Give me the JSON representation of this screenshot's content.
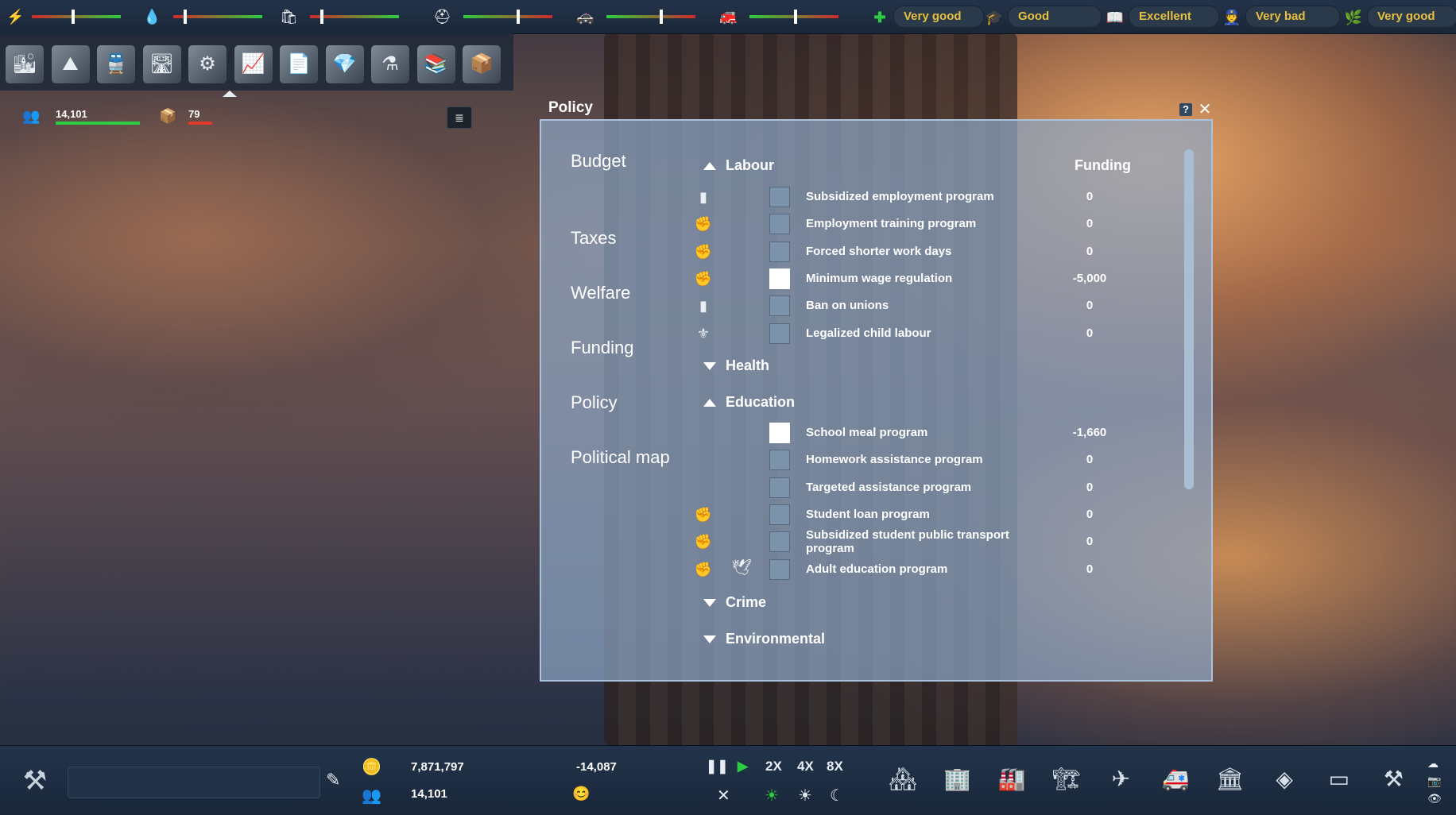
{
  "topbar": {
    "meters": [
      {
        "icon": "lightning-icon",
        "level": 0.45
      },
      {
        "icon": "water-drop-icon",
        "level": 0.12
      },
      {
        "icon": "garbage-bag-icon",
        "level": 0.12
      },
      {
        "icon": "worker-helmet-icon",
        "level": 0.6
      },
      {
        "icon": "police-icon",
        "level": 0.6
      },
      {
        "icon": "fire-icon",
        "level": 0.5
      }
    ],
    "ratings": [
      {
        "icon": "health-cross-icon",
        "label": "Very good"
      },
      {
        "icon": "education-icon",
        "label": "Good"
      },
      {
        "icon": "book-icon",
        "label": "Excellent"
      },
      {
        "icon": "crime-icon",
        "label": "Very bad"
      },
      {
        "icon": "environment-icon",
        "label": "Very good"
      }
    ]
  },
  "toolbar": {
    "tools": [
      {
        "name": "city-overview-tool",
        "glyph": "🏙"
      },
      {
        "name": "terrain-tool",
        "glyph": "⛰"
      },
      {
        "name": "transport-tool",
        "glyph": "🚆"
      },
      {
        "name": "roads-tool",
        "glyph": "🛣"
      },
      {
        "name": "power-tool",
        "glyph": "⚙"
      },
      {
        "name": "economy-tool",
        "glyph": "📈"
      },
      {
        "name": "documents-tool",
        "glyph": "📄"
      },
      {
        "name": "resources-tool",
        "glyph": "💎"
      },
      {
        "name": "research-tool",
        "glyph": "⚗"
      },
      {
        "name": "statistics-tool",
        "glyph": "📚"
      },
      {
        "name": "storage-tool",
        "glyph": "📦"
      }
    ]
  },
  "stats": {
    "population": "14,101",
    "goods": "79"
  },
  "window": {
    "title": "Policy",
    "help": "?",
    "close": "✕",
    "nav": [
      "Budget",
      "Taxes",
      "Welfare",
      "Funding",
      "Policy",
      "Political map"
    ],
    "funding_header": "Funding",
    "sections": [
      {
        "title": "Labour",
        "expanded": true,
        "rows": [
          {
            "icon": "union-icon",
            "glyph": "▮",
            "checked": false,
            "label": "Subsidized employment program",
            "value": "0"
          },
          {
            "icon": "fist-icon",
            "glyph": "✊",
            "checked": false,
            "label": "Employment training program",
            "value": "0"
          },
          {
            "icon": "fist-icon",
            "glyph": "✊",
            "checked": false,
            "label": "Forced shorter work days",
            "value": "0"
          },
          {
            "icon": "fist-icon",
            "glyph": "✊",
            "checked": true,
            "label": "Minimum wage regulation",
            "value": "-5,000"
          },
          {
            "icon": "union-icon",
            "glyph": "▮",
            "checked": false,
            "label": "Ban on unions",
            "value": "0"
          },
          {
            "icon": "eagle-icon",
            "glyph": "⚜",
            "checked": false,
            "label": "Legalized child labour",
            "value": "0"
          }
        ]
      },
      {
        "title": "Health",
        "expanded": false,
        "rows": []
      },
      {
        "title": "Education",
        "expanded": true,
        "rows": [
          {
            "icon": "",
            "glyph": "",
            "checked": true,
            "label": "School meal program",
            "value": "-1,660"
          },
          {
            "icon": "",
            "glyph": "",
            "checked": false,
            "label": "Homework assistance program",
            "value": "0"
          },
          {
            "icon": "",
            "glyph": "",
            "checked": false,
            "label": "Targeted assistance program",
            "value": "0"
          },
          {
            "icon": "fist-icon",
            "glyph": "✊",
            "checked": false,
            "label": "Student loan program",
            "value": "0"
          },
          {
            "icon": "fist-icon",
            "glyph": "✊",
            "checked": false,
            "label": "Subsidized student public transport program",
            "value": "0"
          },
          {
            "icon": "fist-icon",
            "glyph": "✊",
            "icon2": "dove-icon",
            "glyph2": "🕊",
            "checked": false,
            "label": "Adult education program",
            "value": "0"
          }
        ]
      },
      {
        "title": "Crime",
        "expanded": false,
        "rows": []
      },
      {
        "title": "Environmental",
        "expanded": false,
        "rows": []
      }
    ]
  },
  "bottombar": {
    "money": "7,871,797",
    "population": "14,101",
    "delta": "-14,087",
    "speeds": [
      "2X",
      "4X",
      "8X"
    ],
    "buildings": [
      "residential-build-icon",
      "commercial-build-icon",
      "industrial-build-icon",
      "factory-build-icon",
      "transport-build-icon",
      "services-build-icon",
      "government-build-icon",
      "monument-build-icon",
      "warehouse-build-icon",
      "demolish-crane-icon"
    ]
  }
}
